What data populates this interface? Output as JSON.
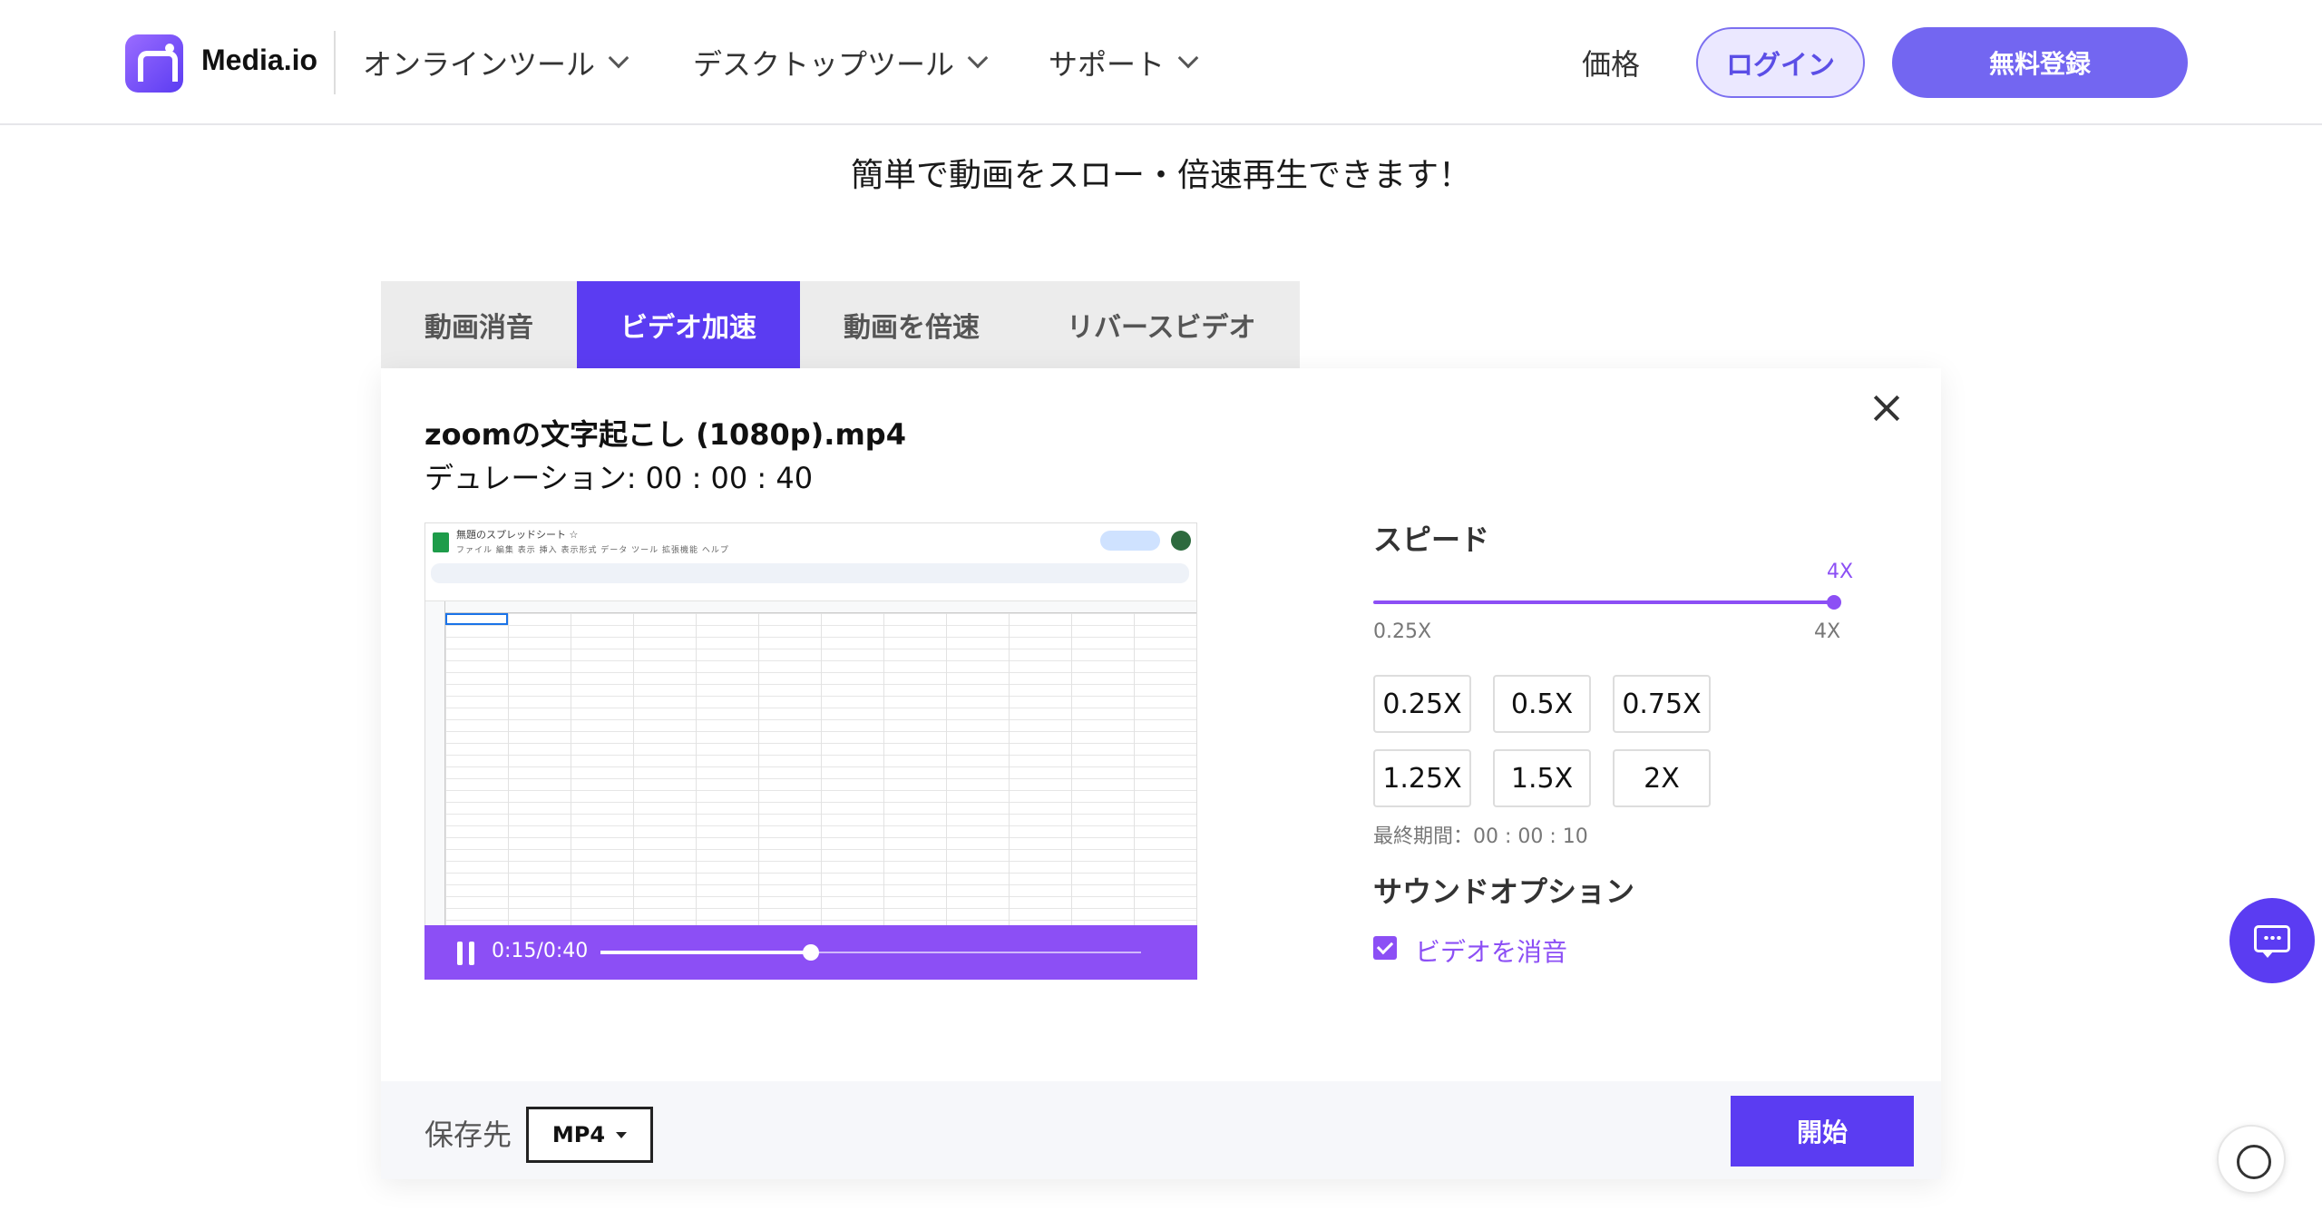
{
  "header": {
    "brand": "Media.io",
    "nav": [
      {
        "label": "オンラインツール"
      },
      {
        "label": "デスクトップツール"
      },
      {
        "label": "サポート"
      }
    ],
    "price": "価格",
    "login": "ログイン",
    "signup": "無料登録"
  },
  "subtitle": "簡単で動画をスロー・倍速再生できます！",
  "tabs": [
    {
      "label": "動画消音",
      "active": false
    },
    {
      "label": "ビデオ加速",
      "active": true
    },
    {
      "label": "動画を倍速",
      "active": false
    },
    {
      "label": "リバースビデオ",
      "active": false
    }
  ],
  "file": {
    "name": "zoomの文字起こし (1080p).mp4",
    "duration": "デュレーション: 00 : 00 : 40"
  },
  "player": {
    "time": "0:15/0:40",
    "progress": 0.39,
    "sheet_title": "無題のスプレッドシート  ☆",
    "sheet_menu": "ファイル  編集  表示  挿入  表示形式  データ  ツール  拡張機能  ヘルプ"
  },
  "speed": {
    "label": "スピード",
    "current": "4X",
    "min_label": "0.25X",
    "max_label": "4X",
    "options": [
      "0.25X",
      "0.5X",
      "0.75X",
      "1.25X",
      "1.5X",
      "2X"
    ],
    "final_time": "最終期間：00 : 00 : 10"
  },
  "sound": {
    "label": "サウンドオプション",
    "mute_label": "ビデオを消音",
    "muted": true
  },
  "footer": {
    "save_to": "保存先",
    "format": "MP4",
    "start": "開始"
  },
  "colors": {
    "accent": "#5b3cf2",
    "purple": "#8c4ff5",
    "signup": "#7366f1"
  }
}
